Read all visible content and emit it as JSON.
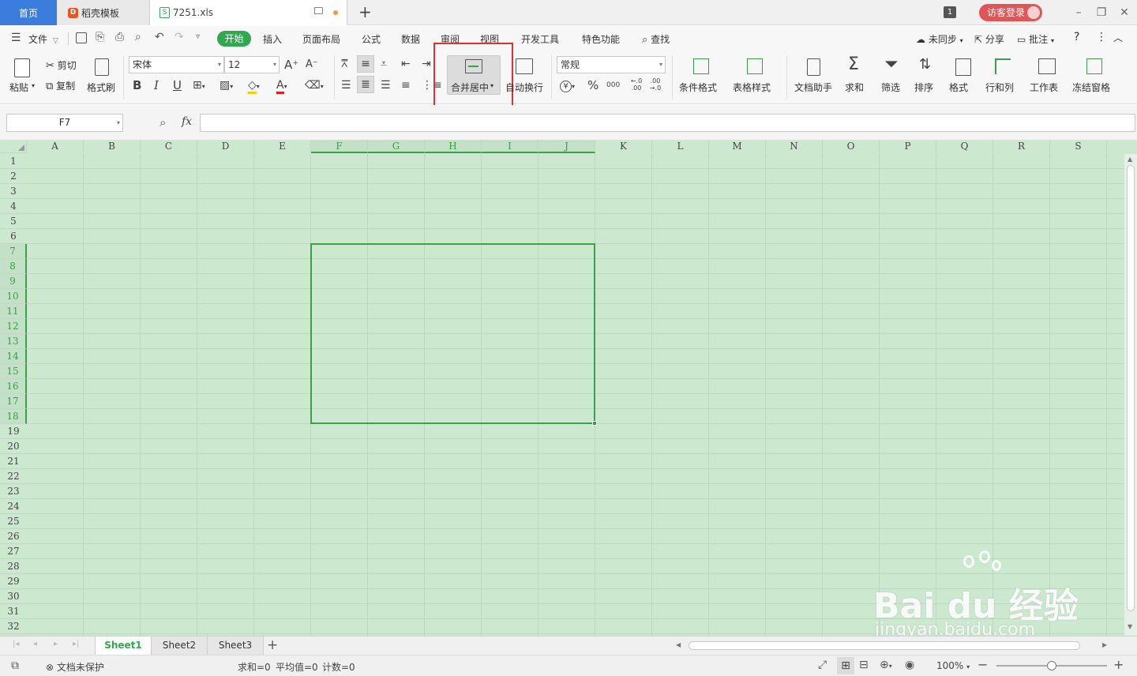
{
  "titlebar": {
    "tabs": [
      {
        "label": "首页"
      },
      {
        "label": "稻壳模板"
      },
      {
        "label": "7251.xls"
      }
    ],
    "add_tab": "+",
    "badge": "1",
    "login": "访客登录"
  },
  "menu": {
    "file": "文件",
    "items": [
      "开始",
      "插入",
      "页面布局",
      "公式",
      "数据",
      "审阅",
      "视图",
      "开发工具",
      "特色功能"
    ],
    "find": "查找",
    "sync": "未同步",
    "share": "分享",
    "comment": "批注",
    "help": "?"
  },
  "ribbon": {
    "paste": "粘贴",
    "cut": "剪切",
    "copy": "复制",
    "format_painter": "格式刷",
    "font_name": "宋体",
    "font_size": "12",
    "grow": "A⁺",
    "shrink": "A⁻",
    "bold": "B",
    "italic": "I",
    "underline": "U",
    "merge": "合并居中",
    "wrap": "自动换行",
    "number_format": "常规",
    "currency": "¥",
    "percent": "%",
    "thousands": "000",
    "inc_decimal": "←.0 .00",
    "dec_decimal": ".00 →.0",
    "cond_format": "条件格式",
    "table_style": "表格样式",
    "doc_helper": "文档助手",
    "sum": "求和",
    "filter": "筛选",
    "sort": "排序",
    "format": "格式",
    "rows_cols": "行和列",
    "worksheet": "工作表",
    "freeze": "冻结窗格"
  },
  "formula_bar": {
    "cell_ref": "F7",
    "fx": "fx",
    "value": ""
  },
  "grid": {
    "columns": [
      "A",
      "B",
      "C",
      "D",
      "E",
      "F",
      "G",
      "H",
      "I",
      "J",
      "K",
      "L",
      "M",
      "N",
      "O",
      "P",
      "Q",
      "R",
      "S"
    ],
    "selected_columns": [
      "F",
      "G",
      "H",
      "I",
      "J"
    ],
    "rows": [
      "1",
      "2",
      "3",
      "4",
      "5",
      "6",
      "7",
      "8",
      "9",
      "10",
      "11",
      "12",
      "13",
      "14",
      "15",
      "16",
      "17",
      "18",
      "19",
      "20",
      "21",
      "22",
      "23",
      "24",
      "25",
      "26",
      "27",
      "28",
      "29",
      "30",
      "31",
      "32"
    ],
    "selected_rows": [
      "7",
      "8",
      "9",
      "10",
      "11",
      "12",
      "13",
      "14",
      "15",
      "16",
      "17",
      "18"
    ]
  },
  "sheets": [
    "Sheet1",
    "Sheet2",
    "Sheet3"
  ],
  "add_sheet": "+",
  "status": {
    "protect": "文档未保护",
    "sum": "求和=0",
    "avg": "平均值=0",
    "count": "计数=0",
    "zoom": "100%"
  },
  "watermark": {
    "brand": "Bai du 经验",
    "url": "jingyan.baidu.com"
  },
  "colors": {
    "accent": "#3b7ddd",
    "start_tab": "#2fa84f",
    "grid_bg": "#cce8cf",
    "selection": "#3aa04a",
    "highlight_box": "#e03030"
  }
}
